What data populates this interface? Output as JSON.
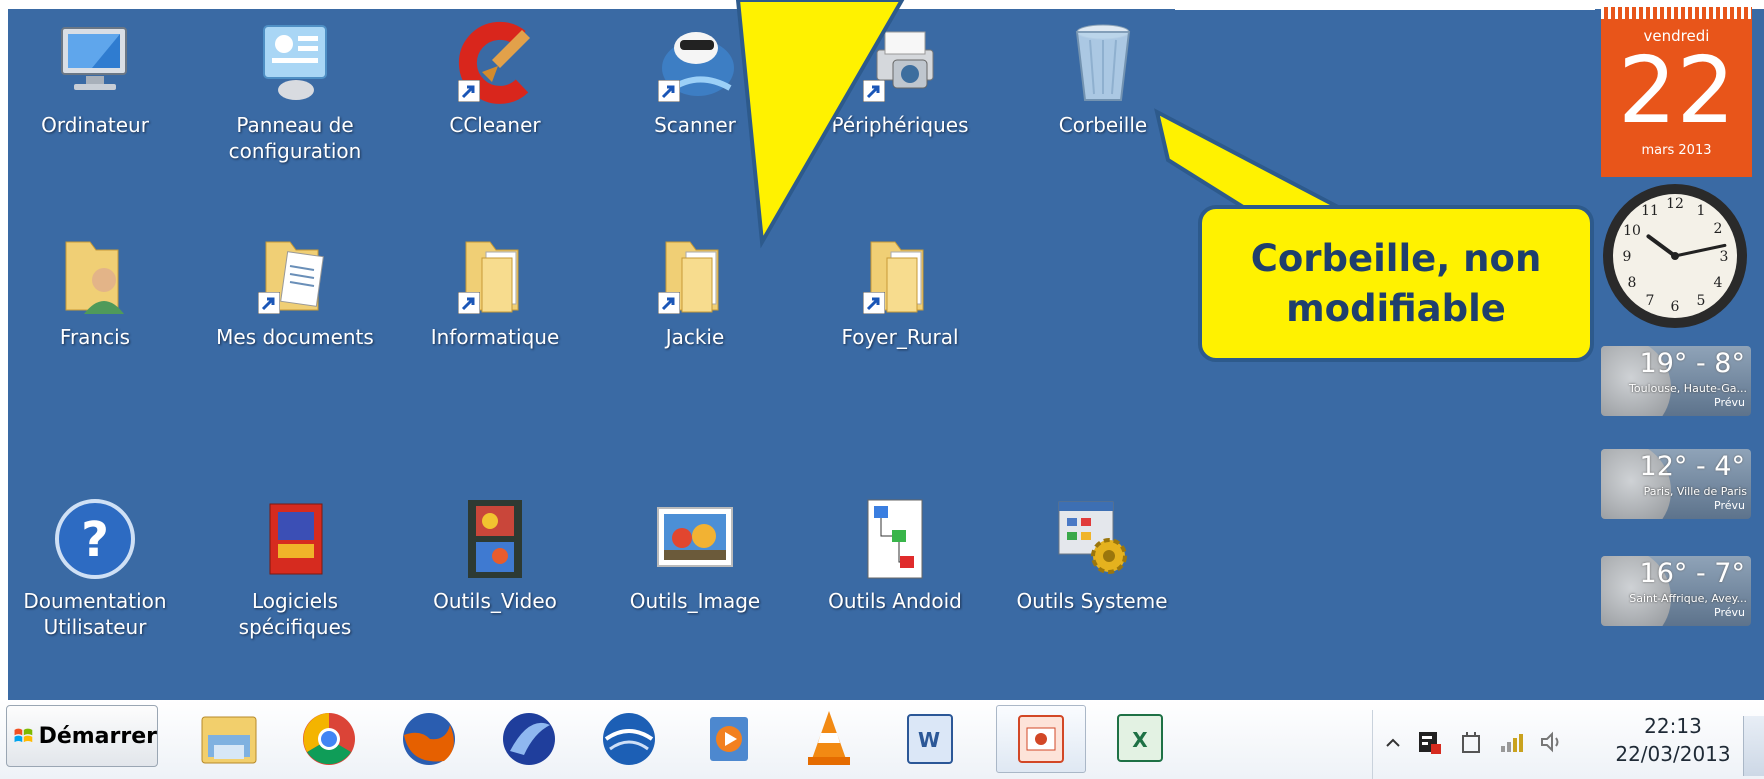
{
  "desktop": {
    "icons": [
      {
        "label": "Ordinateur",
        "icon": "computer-icon"
      },
      {
        "label": "Panneau de configuration",
        "icon": "control-panel-icon"
      },
      {
        "label": "CCleaner",
        "icon": "ccleaner-icon",
        "shortcut": true
      },
      {
        "label": "Scanner",
        "icon": "scanner-icon",
        "shortcut": true
      },
      {
        "label": "Périphériques",
        "icon": "devices-icon",
        "shortcut": true
      },
      {
        "label": "Corbeille",
        "icon": "recycle-bin-icon"
      },
      {
        "label": "Francis",
        "icon": "user-folder-icon"
      },
      {
        "label": "Mes documents",
        "icon": "documents-folder-icon",
        "shortcut": true
      },
      {
        "label": "Informatique",
        "icon": "folder-icon",
        "shortcut": true
      },
      {
        "label": "Jackie",
        "icon": "folder-icon",
        "shortcut": true
      },
      {
        "label": "Foyer_Rural",
        "icon": "folder-icon",
        "shortcut": true
      },
      {
        "label": "Doumentation Utilisateur",
        "icon": "help-icon"
      },
      {
        "label": "Logiciels spécifiques",
        "icon": "book-icon"
      },
      {
        "label": "Outils_Video",
        "icon": "film-icon"
      },
      {
        "label": "Outils_Image",
        "icon": "image-icon"
      },
      {
        "label": "Outils Andoid",
        "icon": "diagram-icon"
      },
      {
        "label": "Outils Systeme",
        "icon": "system-tools-icon"
      }
    ]
  },
  "callout": {
    "text_line1": "Corbeille, non",
    "text_line2": "modifiable"
  },
  "gadgets": {
    "calendar": {
      "day_name": "vendredi",
      "day_number": "22",
      "month_year": "mars 2013"
    },
    "clock": {
      "hour": 10,
      "minute": 13
    },
    "weather": [
      {
        "temp": "19° - 8°",
        "location": "Toulouse, Haute-Ga...",
        "status": "Prévu"
      },
      {
        "temp": "12° - 4°",
        "location": "Paris, Ville de Paris",
        "status": "Prévu"
      },
      {
        "temp": "16° - 7°",
        "location": "Saint-Affrique, Avey...",
        "status": "Prévu"
      }
    ]
  },
  "taskbar": {
    "start_label": "Démarrer",
    "pinned": [
      {
        "name": "explorer",
        "icon": "file-explorer-icon"
      },
      {
        "name": "chrome",
        "icon": "chrome-icon"
      },
      {
        "name": "firefox",
        "icon": "firefox-icon"
      },
      {
        "name": "thunderbird",
        "icon": "thunderbird-icon"
      },
      {
        "name": "google-earth",
        "icon": "google-earth-icon"
      },
      {
        "name": "media-player",
        "icon": "media-player-icon"
      },
      {
        "name": "vlc",
        "icon": "vlc-icon"
      },
      {
        "name": "word",
        "icon": "word-icon"
      },
      {
        "name": "powerpoint",
        "icon": "powerpoint-icon",
        "active": true
      },
      {
        "name": "excel",
        "icon": "excel-icon"
      }
    ],
    "tray": {
      "time": "22:13",
      "date": "22/03/2013"
    }
  },
  "colors": {
    "desktop": "#3a6aa4",
    "callout": "#fff200",
    "callout_text": "#1f3f6d",
    "calendar": "#e8551a"
  }
}
